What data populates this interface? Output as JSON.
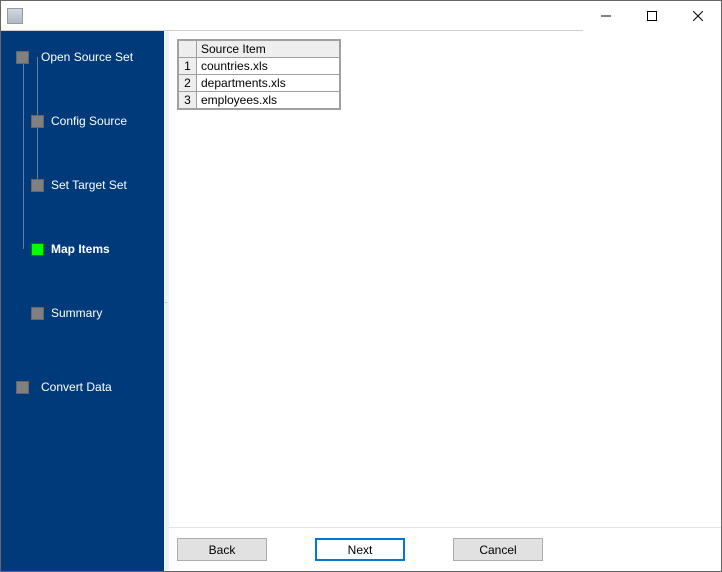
{
  "window": {
    "title": ""
  },
  "sidebar": {
    "items": [
      {
        "label": "Open Source Set"
      },
      {
        "label": "Config Source"
      },
      {
        "label": "Set Target Set"
      },
      {
        "label": "Map Items"
      },
      {
        "label": "Summary"
      },
      {
        "label": "Convert Data"
      }
    ],
    "active_index": 3
  },
  "grid": {
    "header": "Source Item",
    "rows": [
      {
        "num": "1",
        "value": "countries.xls"
      },
      {
        "num": "2",
        "value": "departments.xls"
      },
      {
        "num": "3",
        "value": "employees.xls"
      }
    ]
  },
  "buttons": {
    "back": "Back",
    "next": "Next",
    "cancel": "Cancel"
  }
}
